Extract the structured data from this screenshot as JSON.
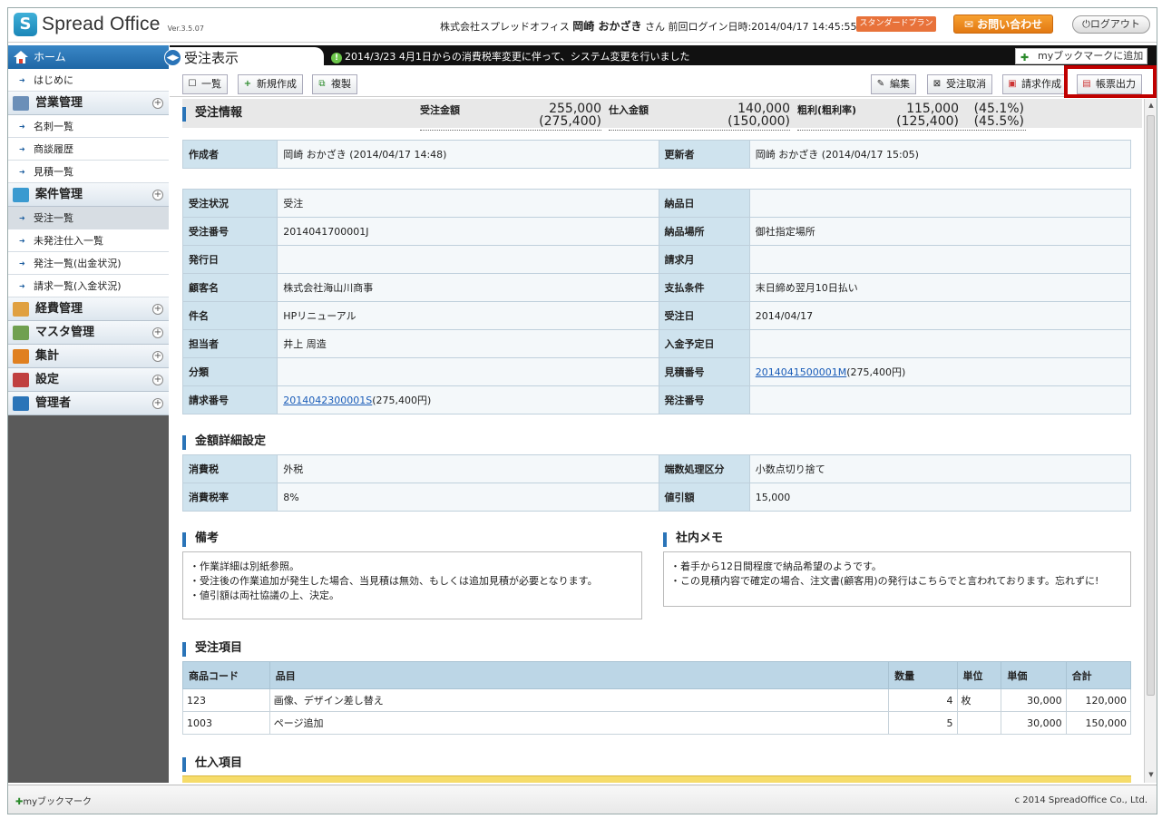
{
  "header": {
    "app_name": "Spread Office",
    "version": "Ver.3.5.07",
    "company": "株式会社スプレッドオフィス",
    "user_name": "岡崎 おかざき",
    "user_suffix": "さん",
    "last_login": "前回ログイン日時:2014/04/17 14:45:55",
    "plan": "スタンダードプラン",
    "contact_label": "お問い合わせ",
    "logout_label": "ログアウト"
  },
  "sidebar": {
    "home": "ホーム",
    "items": [
      {
        "type": "item",
        "label": "はじめに"
      },
      {
        "type": "cat",
        "label": "営業管理",
        "icon": "sales-icon"
      },
      {
        "type": "item",
        "label": "名刺一覧"
      },
      {
        "type": "item",
        "label": "商談履歴"
      },
      {
        "type": "item",
        "label": "見積一覧"
      },
      {
        "type": "cat",
        "label": "案件管理",
        "icon": "project-icon"
      },
      {
        "type": "item",
        "label": "受注一覧",
        "active": true
      },
      {
        "type": "item",
        "label": "未発注仕入一覧"
      },
      {
        "type": "item",
        "label": "発注一覧(出金状況)"
      },
      {
        "type": "item",
        "label": "請求一覧(入金状況)"
      },
      {
        "type": "cat",
        "label": "経費管理",
        "icon": "expense-icon"
      },
      {
        "type": "cat",
        "label": "マスタ管理",
        "icon": "master-icon"
      },
      {
        "type": "cat",
        "label": "集計",
        "icon": "chart-icon"
      },
      {
        "type": "cat",
        "label": "設定",
        "icon": "tools-icon"
      },
      {
        "type": "cat",
        "label": "管理者",
        "icon": "monitor-icon"
      }
    ]
  },
  "main": {
    "title": "受注表示",
    "notice": "2014/3/23  4月1日からの消費税率変更に伴って、システム変更を行いました",
    "bookmark_add": "myブックマークに追加",
    "toolbar": {
      "list": "一覧",
      "new": "新規作成",
      "copy": "複製",
      "edit": "編集",
      "cancel_order": "受注取消",
      "invoice": "請求作成",
      "report": "帳票出力"
    },
    "order_info": {
      "title": "受注情報",
      "order_amount_label": "受注金額",
      "order_amount": "255,000",
      "order_amount_tax": "(275,400)",
      "purchase_amount_label": "仕入金額",
      "purchase_amount": "140,000",
      "purchase_amount_tax": "(150,000)",
      "profit_label": "粗利(粗利率)",
      "profit": "115,000",
      "profit_tax": "(125,400)",
      "profit_rate": "(45.1%)",
      "profit_rate_tax": "(45.5%)"
    },
    "creator_row": {
      "creator_label": "作成者",
      "creator": "岡崎 おかざき (2014/04/17 14:48)",
      "updater_label": "更新者",
      "updater": "岡崎 おかざき (2014/04/17 15:05)"
    },
    "detail_rows": [
      {
        "k1": "受注状況",
        "v1": "受注",
        "k2": "納品日",
        "v2": ""
      },
      {
        "k1": "受注番号",
        "v1": "2014041700001J",
        "k2": "納品場所",
        "v2": "御社指定場所"
      },
      {
        "k1": "発行日",
        "v1": "",
        "k2": "請求月",
        "v2": ""
      },
      {
        "k1": "顧客名",
        "v1": "株式会社海山川商事",
        "k2": "支払条件",
        "v2": "末日締め翌月10日払い"
      },
      {
        "k1": "件名",
        "v1": "HPリニューアル",
        "k2": "受注日",
        "v2": "2014/04/17"
      },
      {
        "k1": "担当者",
        "v1": "井上 周造",
        "k2": "入金予定日",
        "v2": ""
      },
      {
        "k1": "分類",
        "v1": "",
        "k2": "見積番号",
        "v2": ""
      },
      {
        "k1": "請求番号",
        "v1": "",
        "k2": "発注番号",
        "v2": ""
      }
    ],
    "estimate_link": "2014041500001M",
    "estimate_amount": "(275,400円)",
    "invoice_link": "2014042300001S",
    "invoice_amount": "(275,400円)",
    "amount_detail": {
      "title": "金額詳細設定",
      "rows": [
        {
          "k1": "消費税",
          "v1": "外税",
          "k2": "端数処理区分",
          "v2": "小数点切り捨て"
        },
        {
          "k1": "消費税率",
          "v1": "8%",
          "k2": "値引額",
          "v2": "15,000"
        }
      ]
    },
    "remarks": {
      "title": "備考",
      "lines": [
        "・作業詳細は別紙参照。",
        "・受注後の作業追加が発生した場合、当見積は無効、もしくは追加見積が必要となります。",
        "・値引額は両社協議の上、決定。"
      ]
    },
    "internal_memo": {
      "title": "社内メモ",
      "lines": [
        "・着手から12日間程度で納品希望のようです。",
        "・この見積内容で確定の場合、注文書(顧客用)の発行はこちらでと言われております。忘れずに!"
      ]
    },
    "order_items": {
      "title": "受注項目",
      "headers": [
        "商品コード",
        "品目",
        "数量",
        "単位",
        "単価",
        "合計"
      ],
      "rows": [
        [
          "123",
          "画像、デザイン差し替え",
          "4",
          "枚",
          "30,000",
          "120,000"
        ],
        [
          "1003",
          "ページ追加",
          "5",
          "",
          "30,000",
          "150,000"
        ]
      ]
    },
    "purchase_items": {
      "title": "仕入項目"
    }
  },
  "footer": {
    "bookmark": "myブックマーク",
    "copyright": "c 2014 SpreadOffice Co., Ltd."
  },
  "colors": {
    "accent": "#2a74b8",
    "highlight": "#c00000",
    "contact": "#f08c1c",
    "plan": "#e8723a"
  }
}
